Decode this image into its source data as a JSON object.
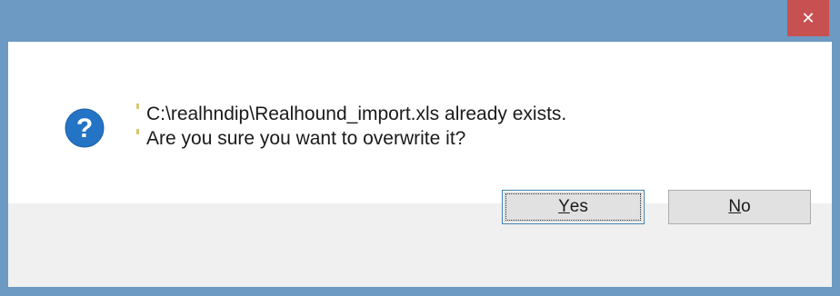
{
  "window": {
    "close_glyph": "✕",
    "accent_color": "#6c9ac3",
    "close_color": "#c75050"
  },
  "dialog": {
    "icon": "question-icon",
    "icon_glyph": "?",
    "message_line1": "C:\\realhndip\\Realhound_import.xls already exists.",
    "message_line2": "Are you sure you want to overwrite it?"
  },
  "buttons": {
    "yes_mnemonic": "Y",
    "yes_rest": "es",
    "no_mnemonic": "N",
    "no_rest": "o"
  }
}
